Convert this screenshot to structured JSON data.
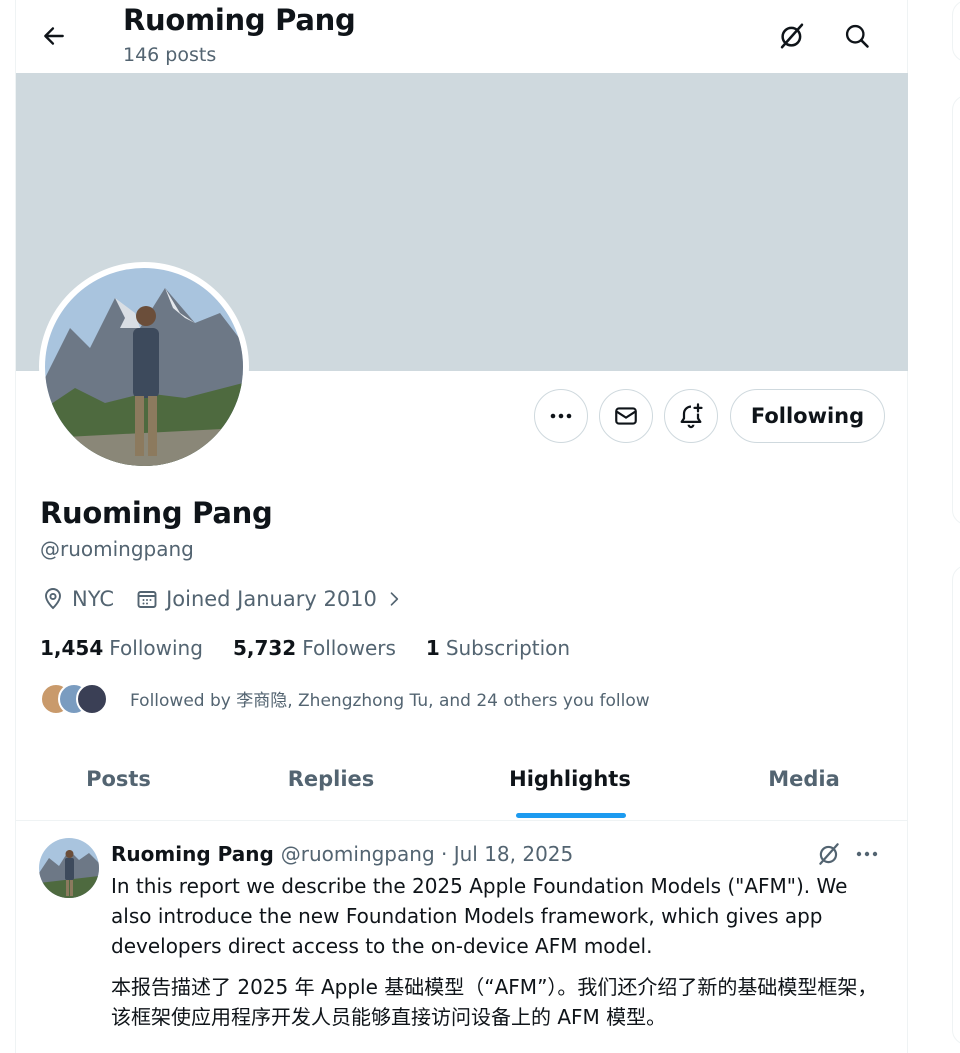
{
  "header": {
    "title": "Ruoming Pang",
    "post_count": "146 posts"
  },
  "profile": {
    "name": "Ruoming Pang",
    "handle": "@ruomingpang",
    "location": "NYC",
    "joined": "Joined January 2010",
    "follow_button": "Following",
    "stats": {
      "following_num": "1,454",
      "following_label": "Following",
      "followers_num": "5,732",
      "followers_label": "Followers",
      "subs_num": "1",
      "subs_label": "Subscription"
    },
    "followed_by": "Followed by 李商隐, Zhengzhong Tu, and 24 others you follow"
  },
  "tabs": [
    {
      "label": "Posts"
    },
    {
      "label": "Replies"
    },
    {
      "label": "Highlights"
    },
    {
      "label": "Media"
    }
  ],
  "post": {
    "name": "Ruoming Pang",
    "meta": "@ruomingpang · Jul 18, 2025",
    "text_en": "In this report we describe the 2025 Apple Foundation Models (\"AFM\"). We also introduce the new Foundation Models framework, which gives app developers direct access to the on-device AFM model.",
    "text_zh": "本报告描述了 2025 年 Apple 基础模型（“AFM”）。我们还介绍了新的基础模型框架，该框架使应用程序开发人员能够直接访问设备上的 AFM 模型。"
  },
  "colors": {
    "accent": "#1d9bf0",
    "banner": "#cfd9de",
    "secondary_text": "#536471"
  },
  "icons": [
    "back-arrow-icon",
    "grok-icon",
    "search-icon",
    "more-icon",
    "message-icon",
    "notification-add-icon",
    "location-icon",
    "calendar-icon",
    "chevron-right-icon"
  ]
}
